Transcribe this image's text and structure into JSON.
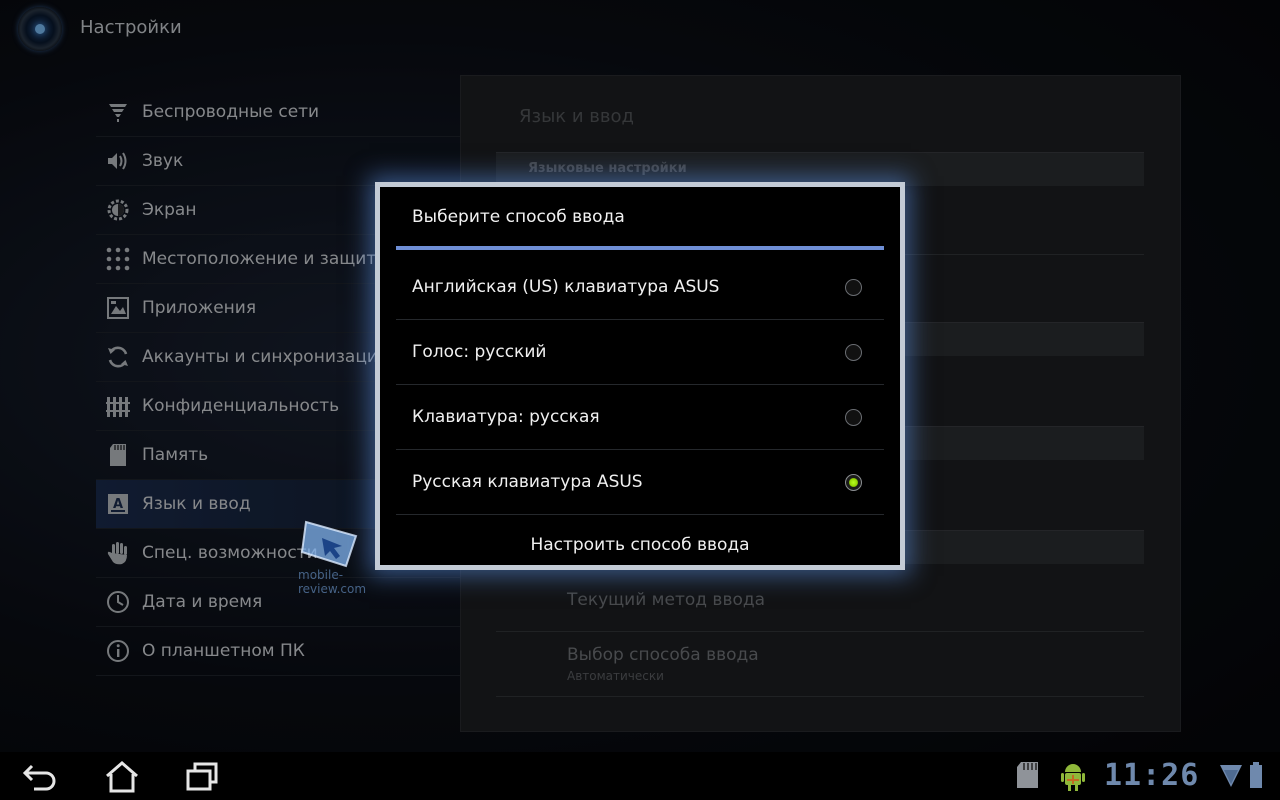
{
  "app": {
    "title": "Настройки"
  },
  "menu": {
    "items": [
      {
        "label": "Беспроводные сети",
        "icon": "wifi-icon"
      },
      {
        "label": "Звук",
        "icon": "speaker-icon"
      },
      {
        "label": "Экран",
        "icon": "brightness-icon"
      },
      {
        "label": "Местоположение и защита",
        "icon": "pattern-lock-icon"
      },
      {
        "label": "Приложения",
        "icon": "apps-icon"
      },
      {
        "label": "Аккаунты и синхронизация",
        "icon": "sync-icon"
      },
      {
        "label": "Конфиденциальность",
        "icon": "privacy-icon"
      },
      {
        "label": "Память",
        "icon": "sd-card-icon"
      },
      {
        "label": "Язык и ввод",
        "icon": "language-icon",
        "selected": true
      },
      {
        "label": "Спец. возможности",
        "icon": "hand-icon"
      },
      {
        "label": "Дата и время",
        "icon": "clock-icon"
      },
      {
        "label": "О планшетном ПК",
        "icon": "info-icon"
      }
    ]
  },
  "right_panel": {
    "title": "Язык и ввод",
    "section_header": "Языковые настройки",
    "current_method": "Текущий метод ввода",
    "choose_method": "Выбор способа ввода",
    "choose_method_sub": "Автоматически"
  },
  "dialog": {
    "title": "Выберите способ ввода",
    "options": [
      {
        "label": "Английская (US) клавиатура ASUS",
        "checked": false
      },
      {
        "label": "Голос: русский",
        "checked": false
      },
      {
        "label": "Клавиатура: русская",
        "checked": false
      },
      {
        "label": "Русская клавиатура ASUS",
        "checked": true
      }
    ],
    "configure_button": "Настроить способ ввода"
  },
  "watermark": {
    "text": "mobile-review.com"
  },
  "system_bar": {
    "time": "11:26",
    "icons": [
      "back-icon",
      "home-icon",
      "recent-apps-icon",
      "sd-card-icon",
      "android-debug-icon",
      "wifi-signal-icon",
      "battery-icon"
    ]
  },
  "colors": {
    "accent": "#6f8fd6",
    "radio_checked": "#9be000",
    "selected_menu": "#1b2c4f",
    "clock": "#6f89ad"
  }
}
